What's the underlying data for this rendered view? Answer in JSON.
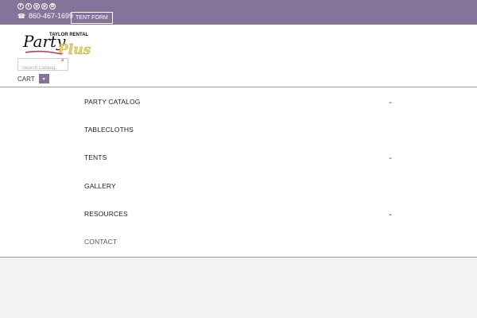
{
  "topbar": {
    "social_icons": [
      {
        "name": "facebook-icon",
        "glyph": "f"
      },
      {
        "name": "twitter-icon",
        "glyph": "t"
      },
      {
        "name": "google-plus-icon",
        "glyph": "g"
      },
      {
        "name": "pinterest-icon",
        "glyph": "p"
      },
      {
        "name": "instagram-icon",
        "glyph": "◘"
      }
    ],
    "phone": "860-467-1699",
    "tent_form_label": "TENT FORM"
  },
  "logo": {
    "word_party": "Party",
    "word_plus": "Plus",
    "tagline": "TAYLOR RENTAL"
  },
  "search": {
    "placeholder": "Search Catalog..."
  },
  "cart": {
    "label": "CART"
  },
  "menu": {
    "items": [
      {
        "label": "PARTY CATALOG",
        "has_dropdown": true
      },
      {
        "label": "TABLECLOTHS",
        "has_dropdown": false
      },
      {
        "label": "TENTS",
        "has_dropdown": true
      },
      {
        "label": "GALLERY",
        "has_dropdown": false
      },
      {
        "label": "RESOURCES",
        "has_dropdown": true
      },
      {
        "label": "CONTACT",
        "has_dropdown": false
      }
    ]
  },
  "colors": {
    "accent": "#857399",
    "logo_yellow": "#e8d26a",
    "logo_pink": "#c8306b"
  }
}
